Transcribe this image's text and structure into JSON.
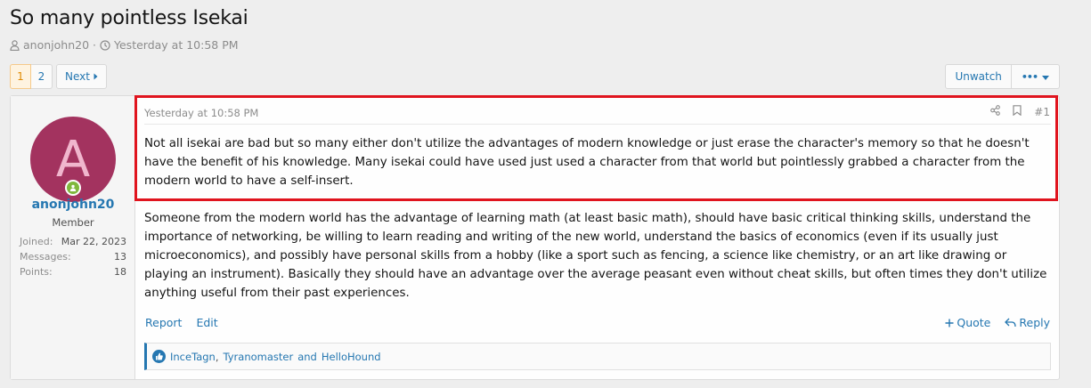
{
  "thread": {
    "title": "So many pointless Isekai",
    "author": "anonjohn20",
    "separator": "·",
    "date": "Yesterday at 10:58 PM"
  },
  "pagination": {
    "pages": [
      "1",
      "2"
    ],
    "current": "1",
    "next_label": "Next"
  },
  "toolbar": {
    "unwatch_label": "Unwatch",
    "more_label": "•••"
  },
  "user": {
    "avatar_letter": "A",
    "username": "anonjohn20",
    "title": "Member",
    "stats": [
      {
        "label": "Joined:",
        "value": "Mar 22, 2023"
      },
      {
        "label": "Messages:",
        "value": "13"
      },
      {
        "label": "Points:",
        "value": "18"
      }
    ]
  },
  "post": {
    "date": "Yesterday at 10:58 PM",
    "number": "#1",
    "paragraph1": "Not all isekai are bad but so many either don't utilize the advantages of modern knowledge or just erase the character's memory so that he doesn't have the benefit of his knowledge. Many isekai could have used just used a character from that world but pointlessly grabbed a character from the modern world to have a self-insert.",
    "paragraph2": "Someone from the modern world has the advantage of learning math (at least basic math), should have basic critical thinking skills, understand the importance of networking, be willing to learn reading and writing of the new world, understand the basics of economics (even if its usually just microeconomics), and possibly have personal skills from a hobby (like a sport such as fencing, a science like chemistry, or an art like drawing or playing an instrument). Basically they should have an advantage over the average peasant even without cheat skills, but often times they don't utilize anything useful from their past experiences.",
    "report_label": "Report",
    "edit_label": "Edit",
    "quote_label": "Quote",
    "reply_label": "Reply"
  },
  "reactions": {
    "users_a": "InceTagn",
    "sep1": ",",
    "users_b": "Tyranomaster",
    "sep2": "and",
    "users_c": "HelloHound"
  },
  "colors": {
    "accent": "#2577b1",
    "avatar_bg": "#a3335f",
    "highlight": "#e0141e",
    "online": "#7fb83d"
  }
}
